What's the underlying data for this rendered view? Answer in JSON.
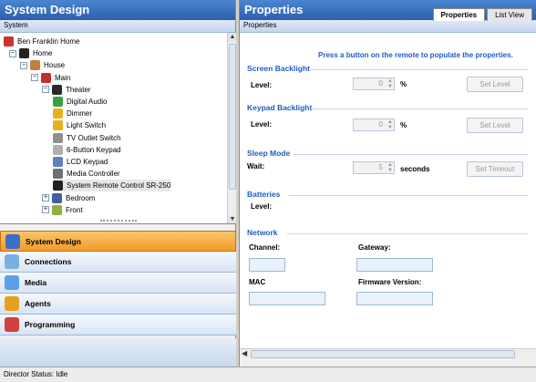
{
  "left": {
    "title": "System Design",
    "subheader": "System",
    "tree": [
      {
        "label": "Ben Franklin Home",
        "icon": "project-icon",
        "color": "#d03030",
        "expander": ""
      },
      {
        "label": "Home",
        "icon": "home-icon",
        "color": "#222222",
        "expander": "−"
      },
      {
        "label": "House",
        "icon": "house-icon",
        "color": "#c08040",
        "expander": "−"
      },
      {
        "label": "Main",
        "icon": "floor-icon",
        "color": "#c03030",
        "expander": "−"
      },
      {
        "label": "Theater",
        "icon": "room-icon",
        "color": "#2a2a2a",
        "expander": "−"
      },
      {
        "label": "Digital Audio",
        "icon": "digital-audio-icon",
        "color": "#3aa048",
        "expander": ""
      },
      {
        "label": "Dimmer",
        "icon": "dimmer-icon",
        "color": "#e8b020",
        "expander": ""
      },
      {
        "label": "Light Switch",
        "icon": "light-switch-icon",
        "color": "#e8b020",
        "expander": ""
      },
      {
        "label": "TV Outlet Switch",
        "icon": "outlet-switch-icon",
        "color": "#909090",
        "expander": ""
      },
      {
        "label": "6-Button Keypad",
        "icon": "keypad-icon",
        "color": "#b0b0b0",
        "expander": ""
      },
      {
        "label": "LCD Keypad",
        "icon": "lcd-keypad-icon",
        "color": "#6080c0",
        "expander": ""
      },
      {
        "label": "Media Controller",
        "icon": "media-controller-icon",
        "color": "#707070",
        "expander": ""
      },
      {
        "label": "System Remote Control SR-250",
        "icon": "remote-icon",
        "color": "#202020",
        "expander": ""
      },
      {
        "label": "Bedroom",
        "icon": "room-icon",
        "color": "#4060a0",
        "expander": "+"
      },
      {
        "label": "Front",
        "icon": "room-icon",
        "color": "#90b040",
        "expander": "+"
      }
    ],
    "nav": [
      {
        "label": "System Design",
        "icon": "system-design-icon",
        "color": "#3b6fc4",
        "active": true
      },
      {
        "label": "Connections",
        "icon": "connections-icon",
        "color": "#7ab0e0",
        "active": false
      },
      {
        "label": "Media",
        "icon": "media-icon",
        "color": "#5aa0e8",
        "active": false
      },
      {
        "label": "Agents",
        "icon": "agents-icon",
        "color": "#e8a020",
        "active": false
      },
      {
        "label": "Programming",
        "icon": "programming-icon",
        "color": "#d04040",
        "active": false
      }
    ]
  },
  "right": {
    "title": "Properties",
    "subheader": "Properties",
    "tabs": [
      "Properties",
      "List View"
    ],
    "hint": "Press a button on the remote to populate the properties.",
    "screen_backlight": {
      "title": "Screen Backlight",
      "level_label": "Level:",
      "level_value": "0",
      "unit": "%",
      "button": "Set Level"
    },
    "keypad_backlight": {
      "title": "Keypad Backlight",
      "level_label": "Level:",
      "level_value": "0",
      "unit": "%",
      "button": "Set Level"
    },
    "sleep_mode": {
      "title": "Sleep Mode",
      "wait_label": "Wait:",
      "wait_value": "5",
      "unit": "seconds",
      "button": "Set Timeout"
    },
    "batteries": {
      "title": "Batteries",
      "level_label": "Level:"
    },
    "network": {
      "title": "Network",
      "channel_label": "Channel:",
      "gateway_label": "Gateway:",
      "mac_label": "MAC",
      "firmware_label": "Firmware Version:"
    }
  },
  "status": "Director Status: Idle"
}
